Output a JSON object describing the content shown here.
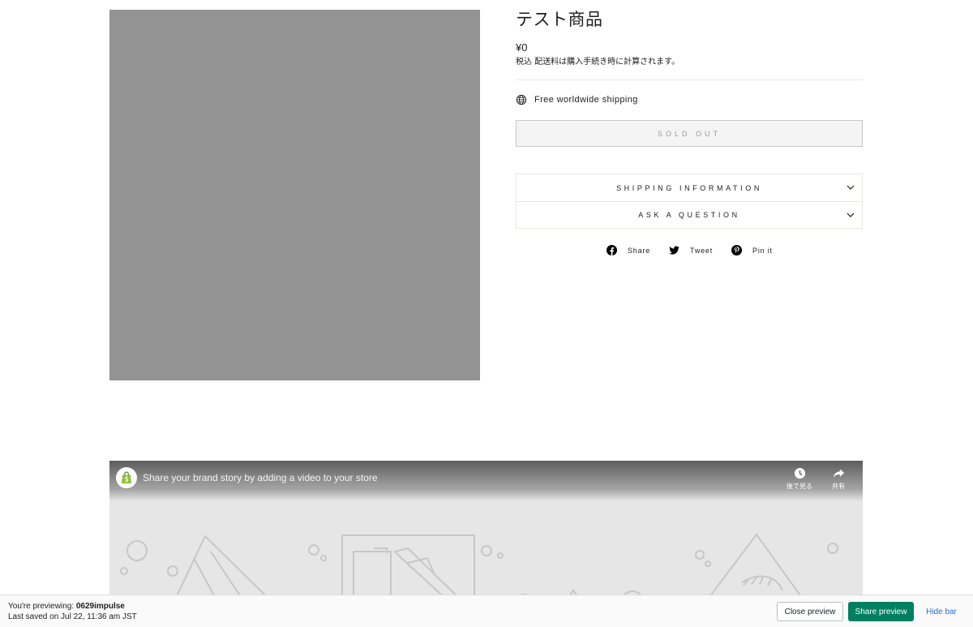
{
  "product": {
    "title": "テスト商品",
    "price": "¥0",
    "tax_note": "税込 配送料は購入手続き時に計算されます。",
    "shipping_note": "Free worldwide shipping",
    "sold_out_label": "SOLD OUT"
  },
  "accordion": {
    "items": [
      {
        "label": "SHIPPING INFORMATION"
      },
      {
        "label": "ASK A QUESTION"
      }
    ]
  },
  "social": {
    "share_label": "Share",
    "tweet_label": "Tweet",
    "pin_label": "Pin it"
  },
  "video": {
    "title": "Share your brand story by adding a video to your store",
    "watch_later_label": "後で見る",
    "share_label": "共有"
  },
  "preview_bar": {
    "previewing_prefix": "You're previewing:",
    "theme_name": "0629impulse",
    "last_saved": "Last saved on Jul 22, 11:36 am JST",
    "close_label": "Close preview",
    "share_label": "Share preview",
    "hide_label": "Hide bar"
  },
  "colors": {
    "image_placeholder": "#939393",
    "share_button": "#008060",
    "hide_link": "#2c6ecb"
  }
}
